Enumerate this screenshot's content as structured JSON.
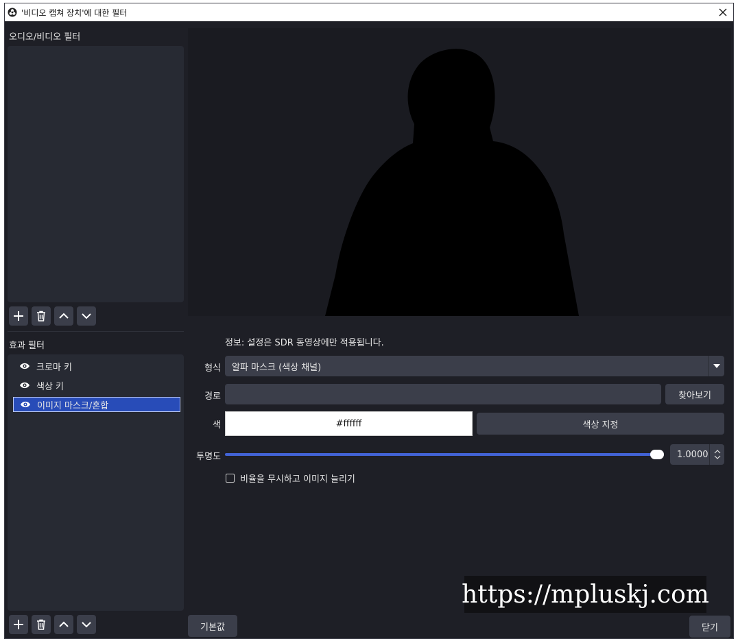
{
  "window": {
    "title": "'비디오 캡쳐 장치'에 대한 필터"
  },
  "audio_video_filters": {
    "label": "오디오/비디오 필터",
    "items": []
  },
  "effect_filters": {
    "label": "효과 필터",
    "items": [
      {
        "label": "크로마 키",
        "selected": false
      },
      {
        "label": "색상 키",
        "selected": false
      },
      {
        "label": "이미지 마스크/혼합",
        "selected": true
      }
    ]
  },
  "properties": {
    "info": "정보: 설정은 SDR 동영상에만 적용됩니다.",
    "type_label": "형식",
    "type_value": "알파 마스크 (색상 채널)",
    "path_label": "경로",
    "path_value": "",
    "browse_label": "찾아보기",
    "color_label": "색",
    "color_value": "#ffffff",
    "select_color_label": "색상 지정",
    "opacity_label": "투명도",
    "opacity_value": "1.0000",
    "opacity_fraction": 1.0,
    "stretch_label": "비율을 무시하고 이미지 늘리기",
    "stretch_checked": false
  },
  "footer": {
    "defaults_label": "기본값",
    "close_label": "닫기"
  },
  "watermark": "https://mpluskj.com",
  "colors": {
    "background": "#1e1f26",
    "panel": "#272a33",
    "button": "#3b3e4a",
    "accent": "#4263d6",
    "selected": "#284cb8"
  },
  "icons": {
    "add": "plus-icon",
    "remove": "trash-icon",
    "up": "chevron-up-icon",
    "down": "chevron-down-icon",
    "visibility": "eye-icon",
    "close": "close-icon"
  }
}
